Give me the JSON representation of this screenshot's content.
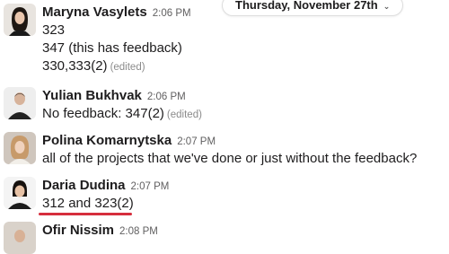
{
  "date_divider": {
    "label": "Thursday, November 27th",
    "chevron_icon": "chevron-down-icon"
  },
  "messages": [
    {
      "name": "Maryna Vasylets",
      "time": "2:06 PM",
      "lines": [
        {
          "text": "323",
          "edited": ""
        },
        {
          "text": "347 (this has feedback)",
          "edited": ""
        },
        {
          "text": "330,333(2)",
          "edited": "(edited)"
        }
      ]
    },
    {
      "name": "Yulian Bukhvak",
      "time": "2:06 PM",
      "lines": [
        {
          "text": "No feedback: 347(2)",
          "edited": "(edited)"
        }
      ]
    },
    {
      "name": "Polina Komarnytska",
      "time": "2:07 PM",
      "lines": [
        {
          "text": "all of the projects that we've done or just without the feedback?",
          "edited": ""
        }
      ]
    },
    {
      "name": "Daria Dudina",
      "time": "2:07 PM",
      "lines": [
        {
          "text": "312 and 323(2)",
          "edited": ""
        }
      ]
    },
    {
      "name": "Ofir Nissim",
      "time": "2:08 PM",
      "lines": []
    }
  ],
  "colors": {
    "annotation_underline": "#d62e3d",
    "link_text": "#1d1c1d"
  }
}
